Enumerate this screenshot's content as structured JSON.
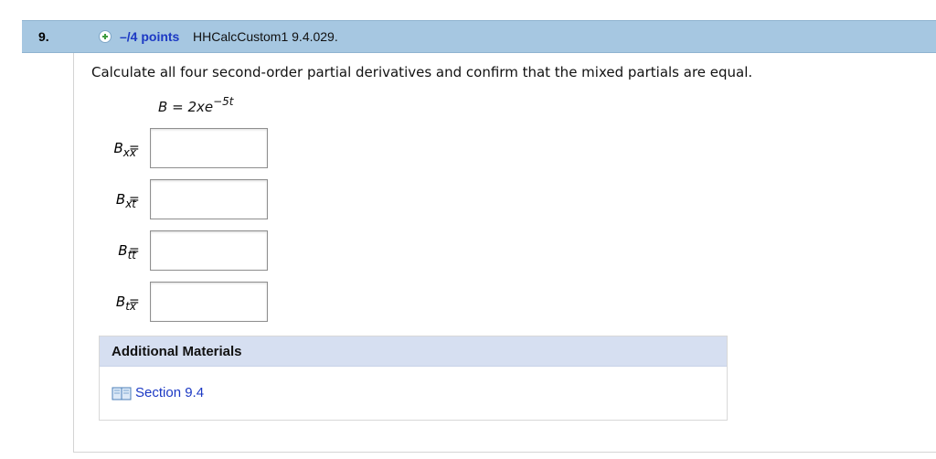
{
  "question": {
    "number": "9.",
    "points": "–/4 points",
    "source": "HHCalcCustom1 9.4.029.",
    "prompt": "Calculate all four second-order partial derivatives and confirm that the mixed partials are equal.",
    "equation": {
      "lhs": "B",
      "equals": "=",
      "rhs_base": "2xe",
      "rhs_exponent": "−5t"
    },
    "answers": [
      {
        "symbol": "B",
        "subscript": "xx",
        "equals": "=",
        "value": ""
      },
      {
        "symbol": "B",
        "subscript": "xt",
        "equals": "=",
        "value": ""
      },
      {
        "symbol": "B",
        "subscript": "tt",
        "equals": "=",
        "value": ""
      },
      {
        "symbol": "B",
        "subscript": "tx",
        "equals": "=",
        "value": ""
      }
    ]
  },
  "additional_materials": {
    "title": "Additional Materials",
    "link_label": "Section 9.4",
    "link_icon": "book-icon"
  },
  "colors": {
    "header_bg": "#a6c7e1",
    "points_text": "#1c39c4",
    "materials_header_bg": "#d6dff1",
    "link_text": "#1c39c4"
  }
}
